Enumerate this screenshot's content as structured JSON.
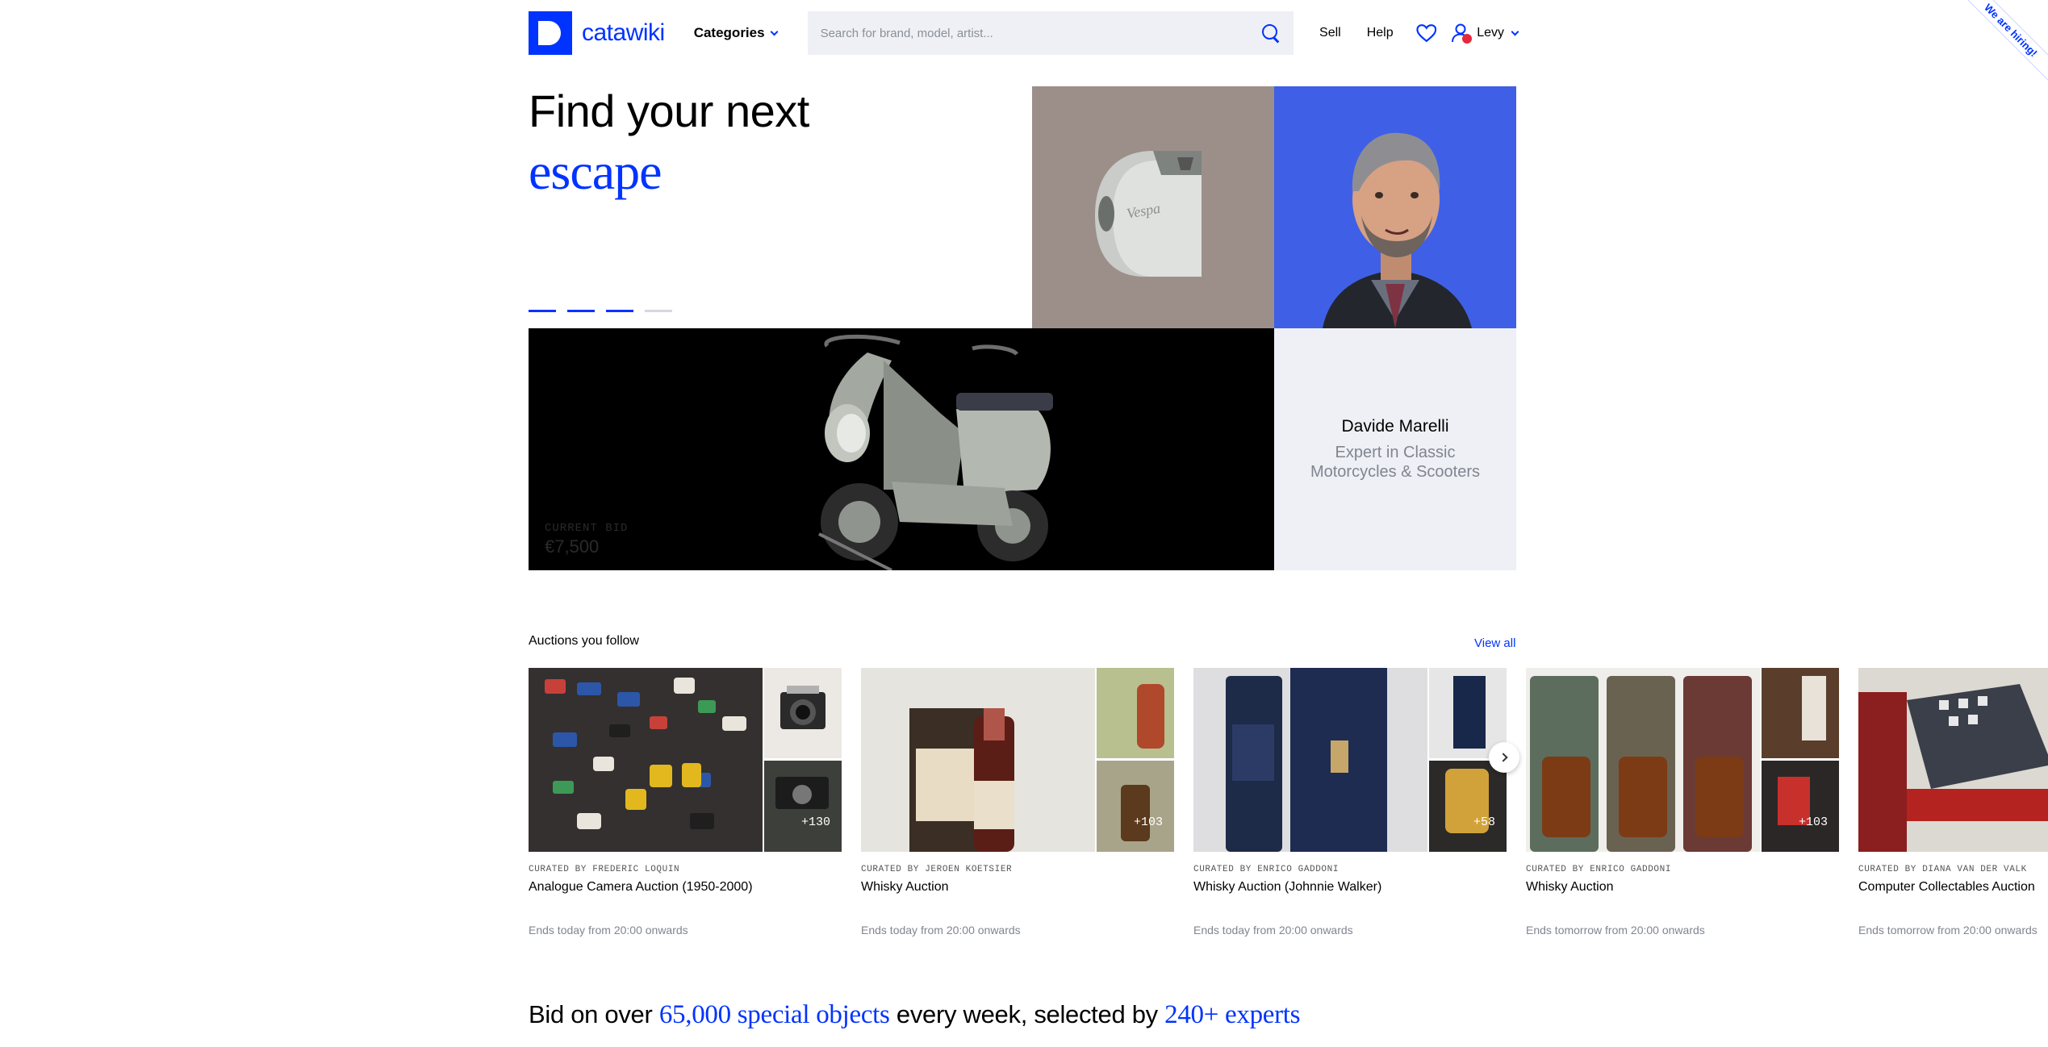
{
  "header": {
    "logo_text": "catawiki",
    "categories_label": "Categories",
    "search_placeholder": "Search for brand, model, artist...",
    "sell_label": "Sell",
    "help_label": "Help",
    "user_name": "Levy",
    "hiring_ribbon": "We are hiring!"
  },
  "hero": {
    "title": "Find your next",
    "accent": "escape",
    "slides_active": 3,
    "slides_total": 4,
    "expert_name": "Davide Marelli",
    "expert_role": "Expert in Classic Motorcycles & Scooters",
    "current_bid_label": "CURRENT BID",
    "current_bid_value": "€7,500"
  },
  "auctions": {
    "section_title": "Auctions you follow",
    "view_all": "View all",
    "cards": [
      {
        "curated_by": "CURATED BY FREDERIC LOQUIN",
        "title": "Analogue Camera Auction (1950-2000)",
        "ends": "Ends today from 20:00 onwards",
        "count": "+130"
      },
      {
        "curated_by": "CURATED BY JEROEN KOETSIER",
        "title": "Whisky Auction",
        "ends": "Ends today from 20:00 onwards",
        "count": "+103"
      },
      {
        "curated_by": "CURATED BY ENRICO GADDONI",
        "title": "Whisky Auction (Johnnie Walker)",
        "ends": "Ends today from 20:00 onwards",
        "count": "+58"
      },
      {
        "curated_by": "CURATED BY ENRICO GADDONI",
        "title": "Whisky Auction",
        "ends": "Ends tomorrow from 20:00 onwards",
        "count": "+103"
      },
      {
        "curated_by": "CURATED BY DIANA VAN DER VALK",
        "title": "Computer Collectables Auction",
        "ends": "Ends tomorrow from 20:00 onwards",
        "count": ""
      }
    ]
  },
  "banner": {
    "part1": "Bid on over ",
    "accent1": "65,000 special objects",
    "part2": " every week, selected by ",
    "accent2": "240+ experts"
  },
  "colors": {
    "brand_blue": "#0033ff",
    "search_bg": "#eef0f5",
    "muted_text": "#808590"
  }
}
